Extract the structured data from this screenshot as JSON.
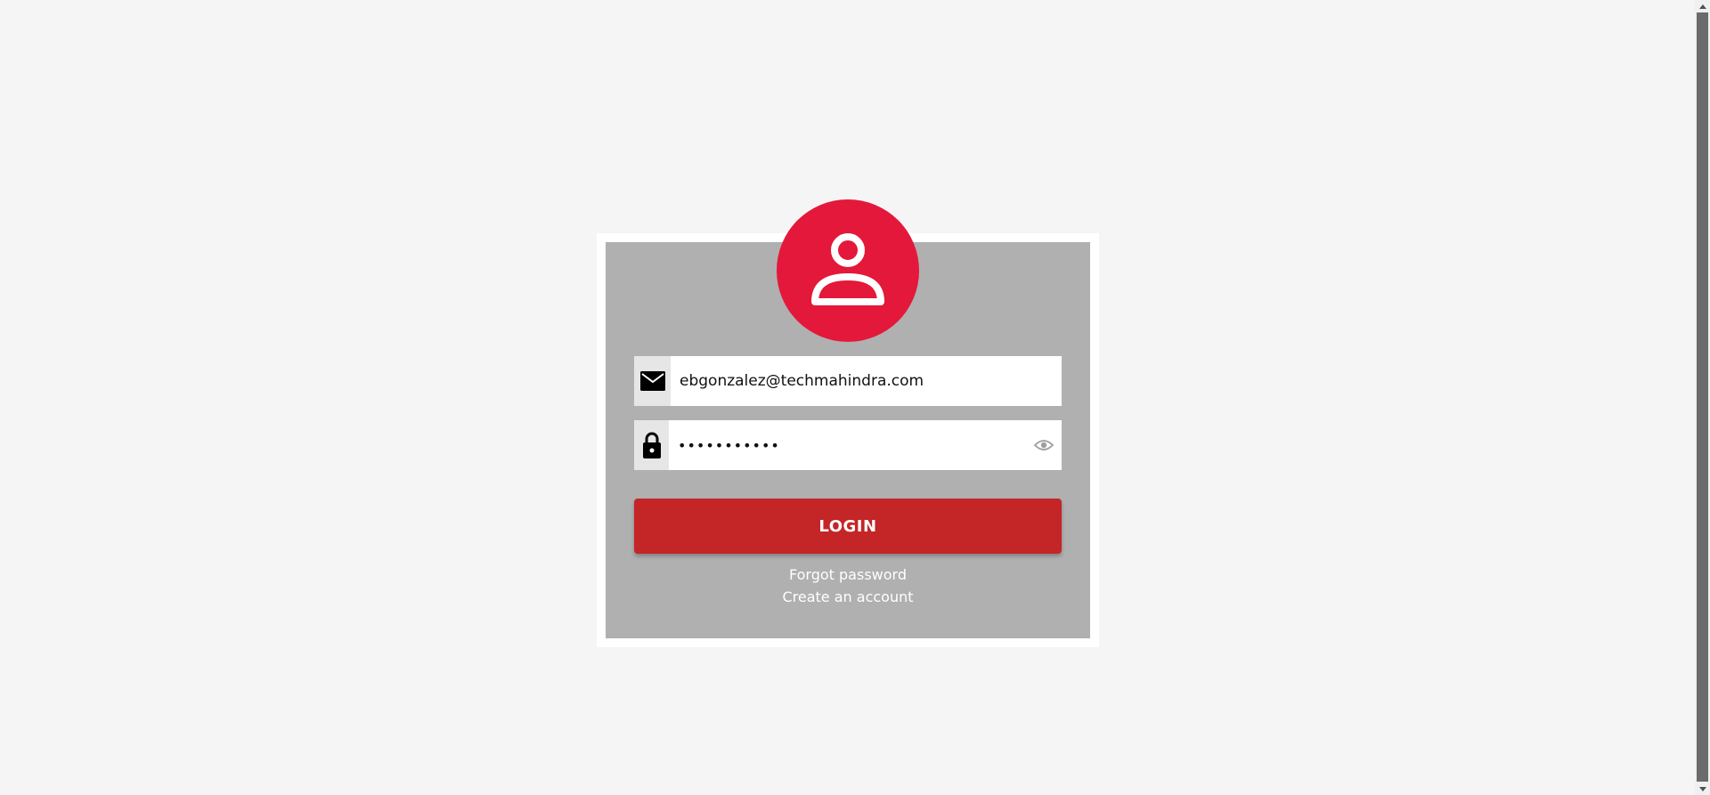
{
  "login_form": {
    "email": {
      "value": "ebgonzalez@techmahindra.com",
      "icon": "mail-icon"
    },
    "password": {
      "value": "•••••••••••",
      "icon": "lock-icon",
      "toggle_icon": "eye-icon"
    },
    "login_label": "LOGIN",
    "forgot_password": "Forgot password",
    "create_account": "Create an account"
  },
  "colors": {
    "page_background": "#f5f5f5",
    "card_background": "#b0b0b0",
    "avatar_red": "#e4183a",
    "button_red": "#c42527"
  }
}
